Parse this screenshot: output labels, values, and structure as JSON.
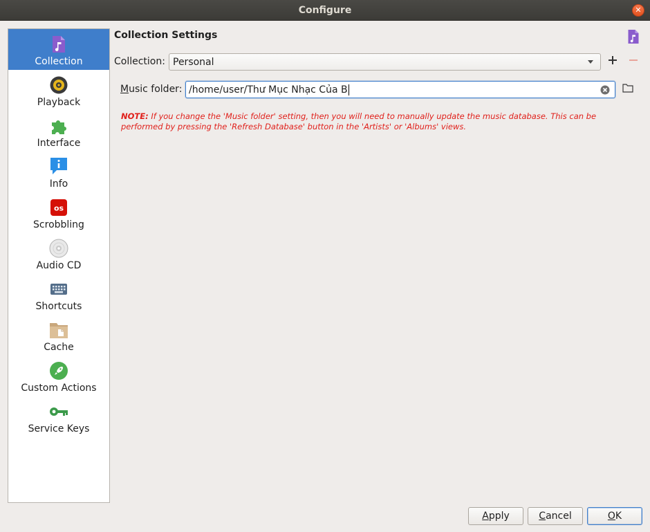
{
  "window": {
    "title": "Configure"
  },
  "sidebar": {
    "items": [
      {
        "label": "Collection",
        "icon": "music-file-icon"
      },
      {
        "label": "Playback",
        "icon": "speaker-icon"
      },
      {
        "label": "Interface",
        "icon": "puzzle-icon"
      },
      {
        "label": "Info",
        "icon": "info-icon"
      },
      {
        "label": "Scrobbling",
        "icon": "lastfm-icon"
      },
      {
        "label": "Audio CD",
        "icon": "cd-icon"
      },
      {
        "label": "Shortcuts",
        "icon": "keyboard-icon"
      },
      {
        "label": "Cache",
        "icon": "folder-cache-icon"
      },
      {
        "label": "Custom Actions",
        "icon": "rocket-icon"
      },
      {
        "label": "Service Keys",
        "icon": "key-icon"
      }
    ],
    "selected": "Collection"
  },
  "main": {
    "heading": "Collection Settings",
    "collection_label": "Collection:",
    "collection_value": "Personal",
    "music_folder_label_first": "M",
    "music_folder_label_rest": "usic folder:",
    "music_folder_value": "/home/user/Thư Mục Nhạc Của B",
    "note_prefix": "NOTE:",
    "note_text": " If you change the 'Music folder' setting, then you will need to manually update the music database. This can be performed by pressing the 'Refresh Database' button in the 'Artists' or 'Albums' views."
  },
  "buttons": {
    "apply_first": "A",
    "apply_rest": "pply",
    "cancel_first": "C",
    "cancel_rest": "ancel",
    "ok_first": "O",
    "ok_rest": "K"
  },
  "colors": {
    "accent": "#3f7ecb",
    "note_red": "#e0201b",
    "titlebar": "#3c3b37"
  }
}
